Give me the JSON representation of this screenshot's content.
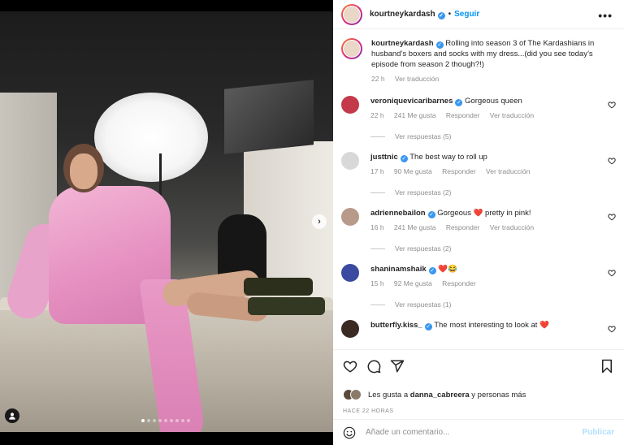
{
  "post": {
    "author": "kourtneykardash",
    "separator": "•",
    "follow_label": "Seguir",
    "more_label": "•••"
  },
  "caption": {
    "author": "kourtneykardash",
    "text": "Rolling into season 3 of The Kardashians in husband’s boxers and socks with my dress...(did you see today’s episode from season 2 though?!)",
    "time": "22 h",
    "translate": "Ver traducción"
  },
  "comments": [
    {
      "username": "veroniquevicaribarnes",
      "text": "Gorgeous queen",
      "time": "22 h",
      "likes": "241 Me gusta",
      "reply": "Responder",
      "translate": "Ver traducción",
      "replies": "Ver respuestas (5)",
      "avatar_color": "#c43a4a"
    },
    {
      "username": "justtnic",
      "text": "The best way to roll up",
      "time": "17 h",
      "likes": "90 Me gusta",
      "reply": "Responder",
      "translate": "Ver traducción",
      "replies": "Ver respuestas (2)",
      "avatar_color": "#d8d8d8"
    },
    {
      "username": "adriennebailon",
      "text": "Gorgeous ❤️ pretty in pink!",
      "time": "16 h",
      "likes": "241 Me gusta",
      "reply": "Responder",
      "translate": "Ver traducción",
      "replies": "Ver respuestas (2)",
      "avatar_color": "#b89a8a"
    },
    {
      "username": "shaninamshaik",
      "text": "❤️😂",
      "time": "15 h",
      "likes": "92 Me gusta",
      "reply": "Responder",
      "replies": "Ver respuestas (1)",
      "avatar_color": "#3a4aa0"
    },
    {
      "username": "butterfly.kiss_",
      "text": "The most interesting to look at ❤️",
      "avatar_color": "#3a2a22"
    }
  ],
  "likes": {
    "prefix": "Les gusta a",
    "user": "danna_cabreera",
    "suffix": "y personas más"
  },
  "timestamp": "HACE 22 HORAS",
  "comment_box": {
    "placeholder": "Añade un comentario...",
    "publish_label": "Publicar"
  },
  "carousel": {
    "total": 9,
    "active": 0,
    "next_arrow": "›"
  },
  "colors": {
    "accent": "#0095f6",
    "verified": "#3897f0",
    "like": "#ed4956"
  },
  "icons": [
    "heart-icon",
    "comment-icon",
    "share-icon",
    "bookmark-icon",
    "emoji-icon",
    "user-tag-icon"
  ]
}
